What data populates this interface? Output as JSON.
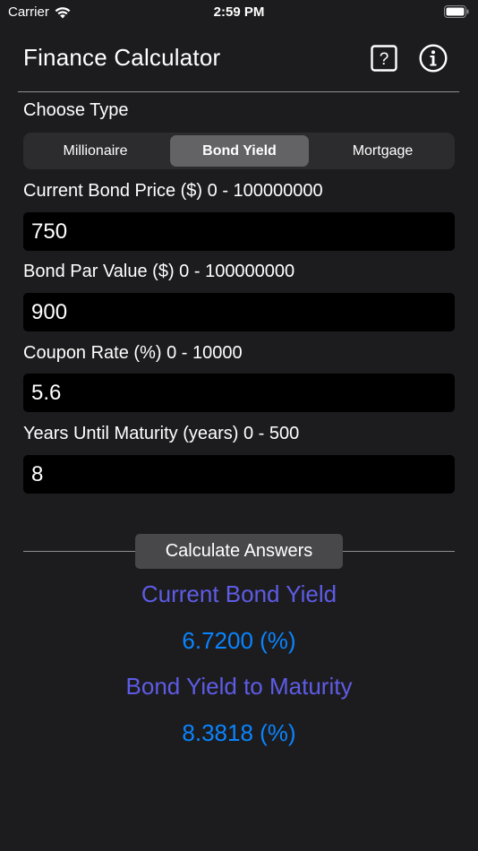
{
  "status_bar": {
    "carrier": "Carrier",
    "time": "2:59 PM"
  },
  "header": {
    "title": "Finance Calculator",
    "help_icon": "question-mark-square-icon",
    "info_icon": "info-circle-icon"
  },
  "type_chooser": {
    "label": "Choose Type",
    "segments": [
      "Millionaire",
      "Bond Yield",
      "Mortgage"
    ],
    "selected": "Bond Yield"
  },
  "fields": [
    {
      "label": "Current Bond Price ($) 0 - 100000000",
      "value": "750"
    },
    {
      "label": "Bond Par Value ($) 0 - 100000000",
      "value": "900"
    },
    {
      "label": "Coupon Rate (%) 0 - 10000",
      "value": "5.6"
    },
    {
      "label": "Years Until Maturity (years) 0 - 500",
      "value": "8"
    }
  ],
  "calculate_button_label": "Calculate Answers",
  "results": [
    {
      "title": "Current Bond Yield",
      "value": "6.7200 (%)"
    },
    {
      "title": "Bond Yield to Maturity",
      "value": "8.3818 (%)"
    }
  ],
  "colors": {
    "background": "#1c1c1e",
    "result_title": "#5e5ce6",
    "result_value": "#0a84ff",
    "input_background": "#000000"
  }
}
